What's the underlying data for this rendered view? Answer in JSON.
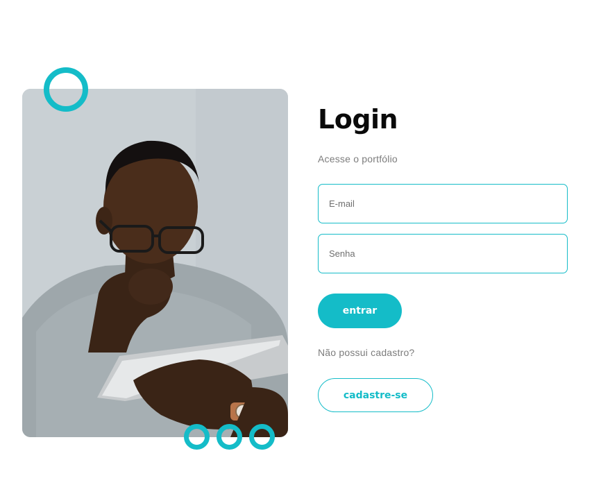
{
  "login": {
    "title": "Login",
    "subtitle": "Acesse o portfólio",
    "email_placeholder": "E-mail",
    "password_placeholder": "Senha",
    "submit_label": "entrar",
    "no_account_text": "Não possui cadastro?",
    "register_label": "cadastre-se"
  },
  "colors": {
    "accent": "#14bcc8",
    "title": "#0a0a0a",
    "muted_text": "#7c7c7c",
    "background": "#ffffff"
  },
  "decorations": [
    "ring-top",
    "ring-small-1",
    "ring-small-2",
    "ring-small-3"
  ]
}
